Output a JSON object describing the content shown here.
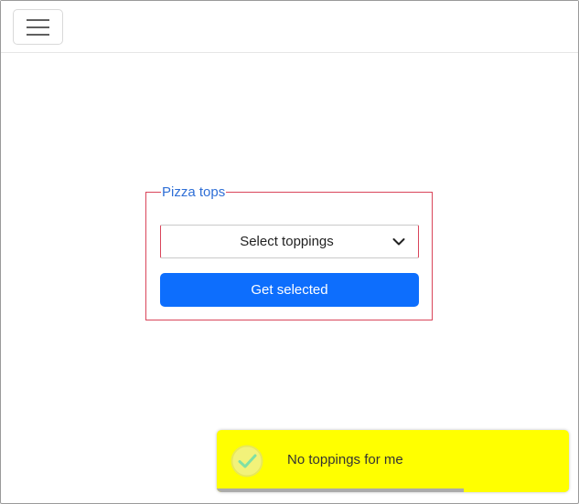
{
  "header": {
    "menu_icon": "hamburger-menu-icon"
  },
  "form": {
    "legend": "Pizza tops",
    "select": {
      "placeholder": "Select toppings",
      "icon": "chevron-down-icon"
    },
    "button_label": "Get selected"
  },
  "toast": {
    "icon": "check-circle-icon",
    "message": "No toppings for me",
    "progress": 0.7,
    "background": "#ffff00",
    "progress_color": "#ababab"
  },
  "colors": {
    "accent": "#0d6efd",
    "fieldset_border": "#d9455a",
    "legend_text": "#2f6fd6"
  }
}
